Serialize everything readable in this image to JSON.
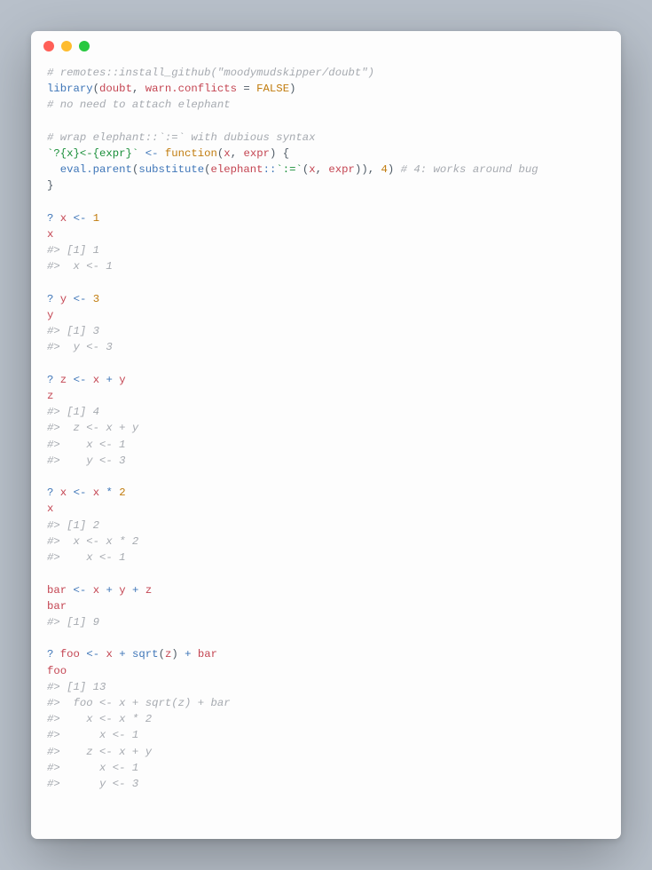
{
  "window": {
    "type": "code-editor",
    "os_style": "macos"
  },
  "traffic_lights": [
    "close",
    "minimize",
    "zoom"
  ],
  "code_tokens": [
    [
      [
        "cm",
        "# remotes::install_github(\"moodymudskipper/doubt\")"
      ]
    ],
    [
      [
        "fn",
        "library"
      ],
      [
        "",
        "("
      ],
      [
        "arg",
        "doubt"
      ],
      [
        "",
        ", "
      ],
      [
        "arg",
        "warn.conflicts"
      ],
      [
        "",
        " = "
      ],
      [
        "kw",
        "FALSE"
      ],
      [
        "",
        ")"
      ]
    ],
    [
      [
        "cm",
        "# no need to attach elephant"
      ]
    ],
    [],
    [
      [
        "cm",
        "# wrap elephant::`:=` with dubious syntax"
      ]
    ],
    [
      [
        "str",
        "`?{x}<-{expr}`"
      ],
      [
        "",
        " "
      ],
      [
        "op",
        "<-"
      ],
      [
        "",
        " "
      ],
      [
        "kw",
        "function"
      ],
      [
        "",
        "("
      ],
      [
        "arg",
        "x"
      ],
      [
        "",
        ", "
      ],
      [
        "arg",
        "expr"
      ],
      [
        "",
        ") {"
      ]
    ],
    [
      [
        "",
        "  "
      ],
      [
        "fn",
        "eval.parent"
      ],
      [
        "",
        "("
      ],
      [
        "fn",
        "substitute"
      ],
      [
        "",
        "("
      ],
      [
        "arg",
        "elephant"
      ],
      [
        "op",
        "::"
      ],
      [
        "str",
        "`:=`"
      ],
      [
        "",
        "("
      ],
      [
        "arg",
        "x"
      ],
      [
        "",
        ", "
      ],
      [
        "arg",
        "expr"
      ],
      [
        "",
        ")), "
      ],
      [
        "kw",
        "4"
      ],
      [
        "",
        ") "
      ],
      [
        "cm",
        "# 4: works around bug"
      ]
    ],
    [
      [
        "",
        "}"
      ]
    ],
    [],
    [
      [
        "op",
        "?"
      ],
      [
        "",
        " "
      ],
      [
        "var",
        "x"
      ],
      [
        "",
        " "
      ],
      [
        "op",
        "<-"
      ],
      [
        "",
        " "
      ],
      [
        "kw",
        "1"
      ]
    ],
    [
      [
        "var",
        "x"
      ]
    ],
    [
      [
        "cm",
        "#> [1] 1"
      ]
    ],
    [
      [
        "cm",
        "#>  x <- 1"
      ]
    ],
    [],
    [
      [
        "op",
        "?"
      ],
      [
        "",
        " "
      ],
      [
        "var",
        "y"
      ],
      [
        "",
        " "
      ],
      [
        "op",
        "<-"
      ],
      [
        "",
        " "
      ],
      [
        "kw",
        "3"
      ]
    ],
    [
      [
        "var",
        "y"
      ]
    ],
    [
      [
        "cm",
        "#> [1] 3"
      ]
    ],
    [
      [
        "cm",
        "#>  y <- 3"
      ]
    ],
    [],
    [
      [
        "op",
        "?"
      ],
      [
        "",
        " "
      ],
      [
        "var",
        "z"
      ],
      [
        "",
        " "
      ],
      [
        "op",
        "<-"
      ],
      [
        "",
        " "
      ],
      [
        "var",
        "x"
      ],
      [
        "",
        " "
      ],
      [
        "op",
        "+"
      ],
      [
        "",
        " "
      ],
      [
        "var",
        "y"
      ]
    ],
    [
      [
        "var",
        "z"
      ]
    ],
    [
      [
        "cm",
        "#> [1] 4"
      ]
    ],
    [
      [
        "cm",
        "#>  z <- x + y"
      ]
    ],
    [
      [
        "cm",
        "#>    x <- 1"
      ]
    ],
    [
      [
        "cm",
        "#>    y <- 3"
      ]
    ],
    [],
    [
      [
        "op",
        "?"
      ],
      [
        "",
        " "
      ],
      [
        "var",
        "x"
      ],
      [
        "",
        " "
      ],
      [
        "op",
        "<-"
      ],
      [
        "",
        " "
      ],
      [
        "var",
        "x"
      ],
      [
        "",
        " "
      ],
      [
        "op",
        "*"
      ],
      [
        "",
        " "
      ],
      [
        "kw",
        "2"
      ]
    ],
    [
      [
        "var",
        "x"
      ]
    ],
    [
      [
        "cm",
        "#> [1] 2"
      ]
    ],
    [
      [
        "cm",
        "#>  x <- x * 2"
      ]
    ],
    [
      [
        "cm",
        "#>    x <- 1"
      ]
    ],
    [],
    [
      [
        "var",
        "bar"
      ],
      [
        "",
        " "
      ],
      [
        "op",
        "<-"
      ],
      [
        "",
        " "
      ],
      [
        "var",
        "x"
      ],
      [
        "",
        " "
      ],
      [
        "op",
        "+"
      ],
      [
        "",
        " "
      ],
      [
        "var",
        "y"
      ],
      [
        "",
        " "
      ],
      [
        "op",
        "+"
      ],
      [
        "",
        " "
      ],
      [
        "var",
        "z"
      ]
    ],
    [
      [
        "var",
        "bar"
      ]
    ],
    [
      [
        "cm",
        "#> [1] 9"
      ]
    ],
    [],
    [
      [
        "op",
        "?"
      ],
      [
        "",
        " "
      ],
      [
        "var",
        "foo"
      ],
      [
        "",
        " "
      ],
      [
        "op",
        "<-"
      ],
      [
        "",
        " "
      ],
      [
        "var",
        "x"
      ],
      [
        "",
        " "
      ],
      [
        "op",
        "+"
      ],
      [
        "",
        " "
      ],
      [
        "fn",
        "sqrt"
      ],
      [
        "",
        "("
      ],
      [
        "var",
        "z"
      ],
      [
        "",
        ") "
      ],
      [
        "op",
        "+"
      ],
      [
        "",
        " "
      ],
      [
        "var",
        "bar"
      ]
    ],
    [
      [
        "var",
        "foo"
      ]
    ],
    [
      [
        "cm",
        "#> [1] 13"
      ]
    ],
    [
      [
        "cm",
        "#>  foo <- x + sqrt(z) + bar"
      ]
    ],
    [
      [
        "cm",
        "#>    x <- x * 2"
      ]
    ],
    [
      [
        "cm",
        "#>      x <- 1"
      ]
    ],
    [
      [
        "cm",
        "#>    z <- x + y"
      ]
    ],
    [
      [
        "cm",
        "#>      x <- 1"
      ]
    ],
    [
      [
        "cm",
        "#>      y <- 3"
      ]
    ]
  ]
}
